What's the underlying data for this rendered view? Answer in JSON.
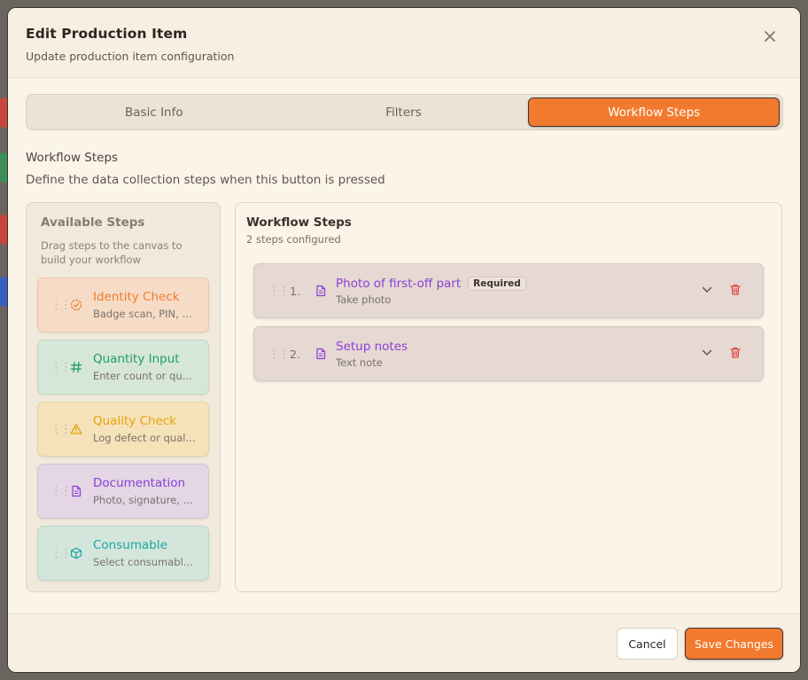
{
  "modal": {
    "title": "Edit Production Item",
    "subtitle": "Update production item configuration"
  },
  "tabs": [
    {
      "label": "Basic Info",
      "active": false
    },
    {
      "label": "Filters",
      "active": false
    },
    {
      "label": "Workflow Steps",
      "active": true
    }
  ],
  "section": {
    "title": "Workflow Steps",
    "description": "Define the data collection steps when this button is pressed"
  },
  "available": {
    "title": "Available Steps",
    "hint": "Drag steps to the canvas to build your workflow",
    "steps": [
      {
        "label": "Identity Check",
        "description": "Badge scan, PIN, or...",
        "icon": "badge-check-icon",
        "color": "#f07a2a",
        "bg": "#f6dcc6",
        "border": "#ecc7a8"
      },
      {
        "label": "Quantity Input",
        "description": "Enter count or qu...",
        "icon": "hash-icon",
        "color": "#1f9e6a",
        "bg": "#d6e6d8",
        "border": "#c2d9c6"
      },
      {
        "label": "Quality Check",
        "description": "Log defect or qual...",
        "icon": "alert-triangle-icon",
        "color": "#e8a20c",
        "bg": "#f5e2b8",
        "border": "#ead19c"
      },
      {
        "label": "Documentation",
        "description": "Photo, signature, ...",
        "icon": "file-text-icon",
        "color": "#8a3fd8",
        "bg": "#e4d6e4",
        "border": "#d5c4d6"
      },
      {
        "label": "Consumable",
        "description": "Select consumabl...",
        "icon": "box-icon",
        "color": "#1aa5a0",
        "bg": "#d4e6dc",
        "border": "#bed8cc"
      }
    ]
  },
  "canvas": {
    "title": "Workflow Steps",
    "subtitle": "2 steps configured",
    "items": [
      {
        "number": "1.",
        "label": "Photo of first-off part",
        "type": "Take photo",
        "badge": "Required"
      },
      {
        "number": "2.",
        "label": "Setup notes",
        "type": "Text note",
        "badge": ""
      }
    ]
  },
  "footer": {
    "cancel_label": "Cancel",
    "save_label": "Save Changes"
  },
  "colors": {
    "accent": "#f27a2e",
    "purple": "#8a3fd8",
    "danger": "#e04444"
  }
}
